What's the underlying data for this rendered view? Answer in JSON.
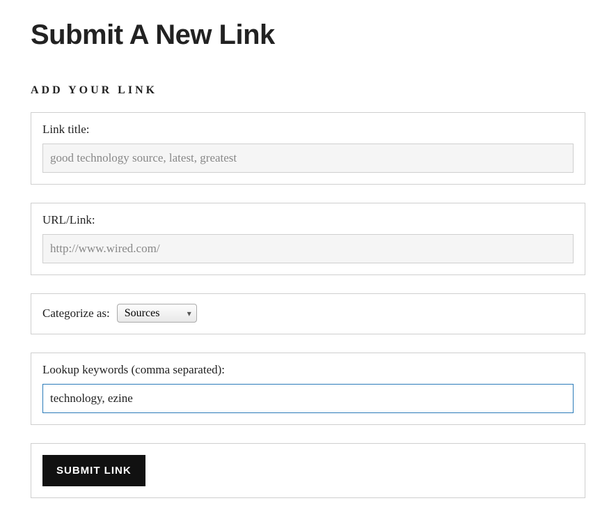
{
  "page": {
    "title": "Submit A New Link",
    "section_heading": "ADD YOUR LINK"
  },
  "fields": {
    "link_title": {
      "label": "Link title:",
      "value": "good technology source, latest, greatest"
    },
    "url_link": {
      "label": "URL/Link:",
      "value": "http://www.wired.com/"
    },
    "categorize": {
      "label": "Categorize as:",
      "selected": "Sources"
    },
    "keywords": {
      "label": "Lookup keywords (comma separated):",
      "value": "technology, ezine"
    }
  },
  "buttons": {
    "submit_label": "SUBMIT LINK"
  }
}
